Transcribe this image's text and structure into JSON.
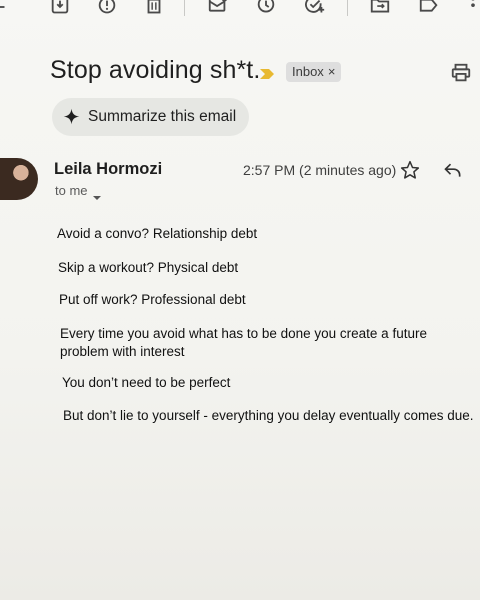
{
  "toolbar": {
    "icons": [
      "back-icon",
      "archive-icon",
      "report-spam-icon",
      "delete-icon",
      "mark-unread-icon",
      "snooze-icon",
      "add-to-tasks-icon",
      "move-to-icon",
      "label-icon",
      "more-options-icon"
    ]
  },
  "email": {
    "subject": "Stop avoiding sh*t.",
    "label": "Inbox",
    "label_close": "×",
    "summarize_label": "Summarize this email",
    "sender": "Leila Hormozi",
    "recipient": "to me",
    "timestamp": "2:57 PM (2 minutes ago)",
    "body": [
      "Avoid a convo? Relationship debt",
      "Skip a workout? Physical debt",
      "Put off work? Professional debt",
      "Every time you avoid what has to be done you create a future problem with interest",
      "You don’t need to be perfect",
      "But don’t lie to yourself - everything you delay eventually comes due."
    ]
  },
  "colors": {
    "background": "#f5f5f1",
    "important_marker": "#e8b931",
    "chip": "#dedede",
    "summarize_button": "#e6e7e3"
  }
}
